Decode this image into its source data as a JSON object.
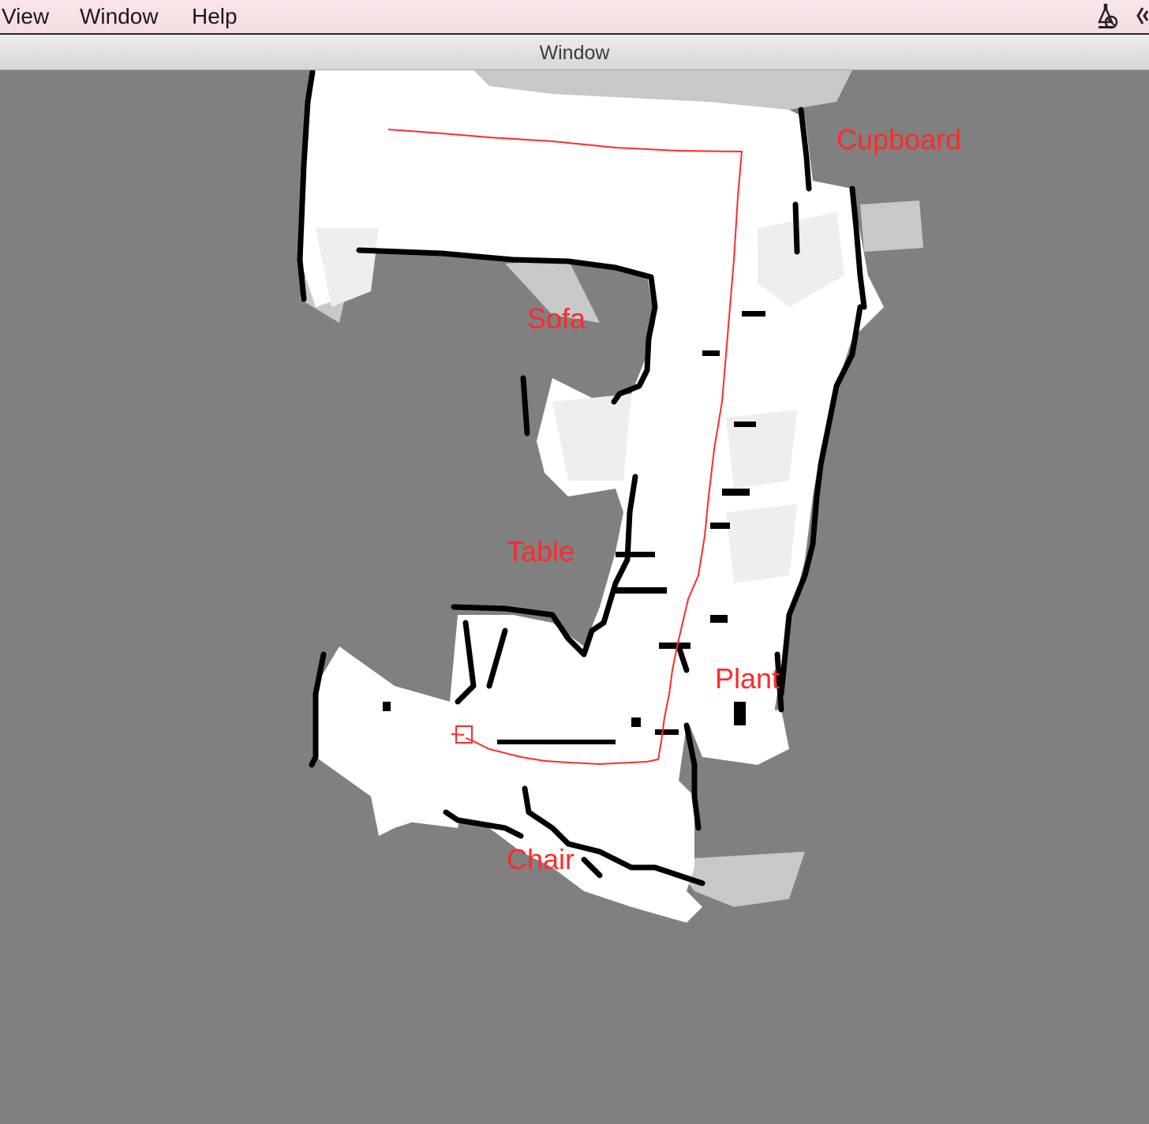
{
  "menubar": {
    "items": [
      {
        "label": "View"
      },
      {
        "label": "Window"
      },
      {
        "label": "Help"
      }
    ],
    "status_icons": [
      "app-status-icon",
      "overflow-status-icon"
    ]
  },
  "window": {
    "title": "Window"
  },
  "map": {
    "labels": {
      "cupboard": "Cupboard",
      "sofa": "Sofa",
      "table": "Table",
      "plant": "Plant",
      "chair": "Chair"
    },
    "colors": {
      "unknown": "#808080",
      "free": "#ffffff",
      "obstacle": "#000000",
      "path": "#ff2a2a",
      "label": "#ff2a2a"
    }
  }
}
